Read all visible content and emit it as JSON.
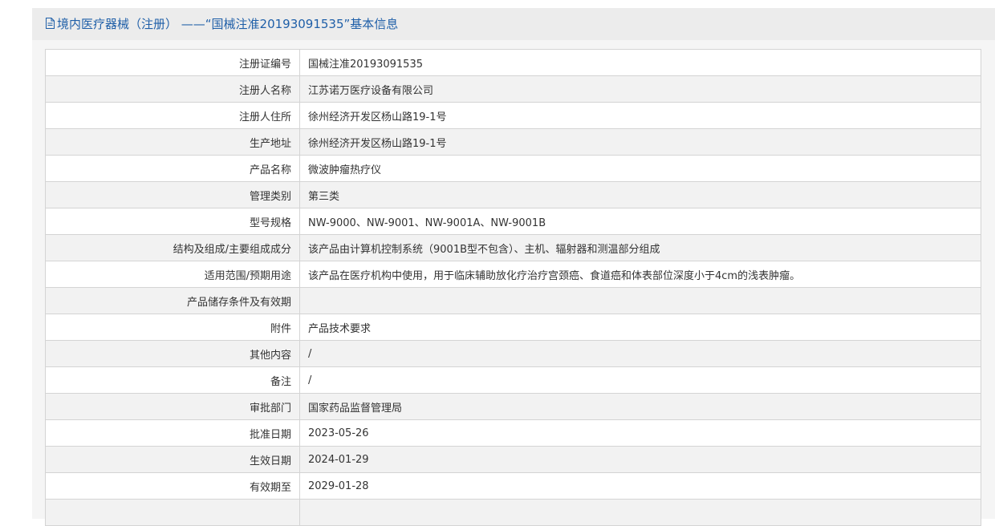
{
  "header": {
    "icon": "document-icon",
    "title": "境内医疗器械（注册） ——“国械注准20193091535”基本信息"
  },
  "rows": [
    {
      "label": "注册证编号",
      "value": "国械注准20193091535"
    },
    {
      "label": "注册人名称",
      "value": "江苏诺万医疗设备有限公司"
    },
    {
      "label": "注册人住所",
      "value": "徐州经济开发区杨山路19-1号"
    },
    {
      "label": "生产地址",
      "value": "徐州经济开发区杨山路19-1号"
    },
    {
      "label": "产品名称",
      "value": "微波肿瘤热疗仪"
    },
    {
      "label": "管理类别",
      "value": "第三类"
    },
    {
      "label": "型号规格",
      "value": "NW-9000、NW-9001、NW-9001A、NW-9001B"
    },
    {
      "label": "结构及组成/主要组成成分",
      "value": "该产品由计算机控制系统（9001B型不包含）、主机、辐射器和测温部分组成"
    },
    {
      "label": "适用范围/预期用途",
      "value": "该产品在医疗机构中使用，用于临床辅助放化疗治疗宫颈癌、食道癌和体表部位深度小于4cm的浅表肿瘤。"
    },
    {
      "label": "产品储存条件及有效期",
      "value": ""
    },
    {
      "label": "附件",
      "value": "产品技术要求"
    },
    {
      "label": "其他内容",
      "value": "/"
    },
    {
      "label": "备注",
      "value": "/"
    },
    {
      "label": "审批部门",
      "value": "国家药品监督管理局"
    },
    {
      "label": "批准日期",
      "value": "2023-05-26"
    },
    {
      "label": "生效日期",
      "value": "2024-01-29"
    },
    {
      "label": "有效期至",
      "value": "2029-01-28"
    },
    {
      "label": "",
      "value": ""
    }
  ],
  "colors": {
    "title": "#1f5fa8",
    "border": "#d4d4d4",
    "stripe": "#f2f2f2"
  }
}
